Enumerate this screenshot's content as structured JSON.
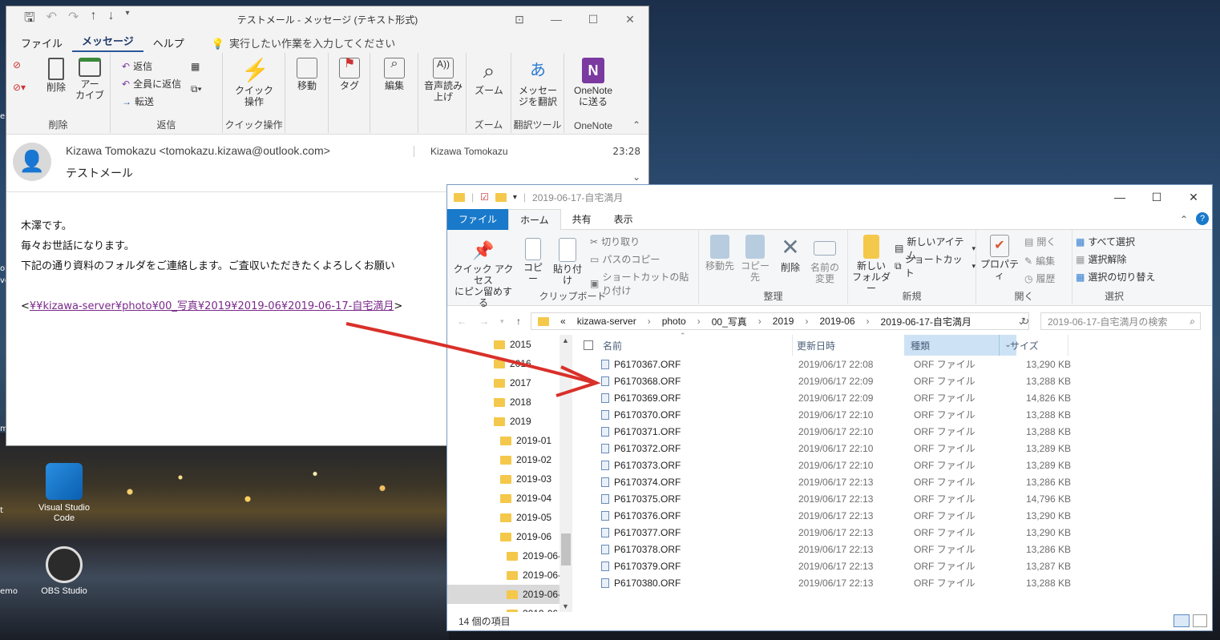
{
  "desktop": {
    "icons": [
      {
        "label": "Visual Studio Code"
      },
      {
        "label": "OBS Studio"
      }
    ],
    "edge_labels": [
      "e",
      "ol",
      "ve",
      "m",
      "t",
      "emo"
    ]
  },
  "outlook": {
    "title": "テストメール  -  メッセージ (テキスト形式)",
    "menu": [
      "ファイル",
      "メッセージ",
      "ヘルプ"
    ],
    "tell_me": "実行したい作業を入力してください",
    "ribbon": {
      "delete_group": "削除",
      "delete": "削除",
      "archive": "アー\nカイブ",
      "reply_group": "返信",
      "reply": "返信",
      "reply_all": "全員に返信",
      "forward": "転送",
      "quick_group": "クイック操作",
      "quick": "クイック\n操作",
      "move": "移動",
      "tag": "タグ",
      "edit": "編集",
      "read_aloud": "音声読み\n上げ",
      "zoom_group": "ズーム",
      "zoom": "ズーム",
      "translate_group": "翻訳ツール",
      "translate": "メッセー\nジを翻訳",
      "onenote_group": "OneNote",
      "onenote": "OneNote\nに送る"
    },
    "header": {
      "from": "Kizawa Tomokazu <tomokazu.kizawa@outlook.com>",
      "to": "Kizawa Tomokazu",
      "time": "23:28",
      "subject": "テストメール"
    },
    "body": [
      "木澤です。",
      "毎々お世話になります。",
      "下記の通り資料のフォルダをご連絡します。ご査収いただきたくよろしくお願い"
    ],
    "link_open": "<",
    "link": "¥¥kizawa-server¥photo¥00_写真¥2019¥2019-06¥2019-06-17-自宅満月",
    "link_close": ">"
  },
  "explorer": {
    "title": "2019-06-17-自宅満月",
    "tabs": [
      "ファイル",
      "ホーム",
      "共有",
      "表示"
    ],
    "ribbon": {
      "pin": "クイック アクセス\nにピン留めする",
      "copy": "コピー",
      "paste": "貼り付け",
      "cut": "切り取り",
      "copy_path": "パスのコピー",
      "paste_shortcut": "ショートカットの貼り付け",
      "clipboard_group": "クリップボード",
      "move_to": "移動先",
      "copy_to": "コピー先",
      "delete": "削除",
      "rename": "名前の\n変更",
      "organize_group": "整理",
      "new_folder": "新しい\nフォルダー",
      "new_item": "新しいアイテム",
      "shortcut": "ショートカット",
      "new_group": "新規",
      "properties": "プロパティ",
      "open": "開く",
      "edit": "編集",
      "history": "履歴",
      "open_group": "開く",
      "select_all": "すべて選択",
      "select_none": "選択解除",
      "invert": "選択の切り替え",
      "select_group": "選択"
    },
    "address": [
      "«",
      "kizawa-server",
      "photo",
      "00_写真",
      "2019",
      "2019-06",
      "2019-06-17-自宅満月"
    ],
    "search_placeholder": "2019-06-17-自宅満月の検索",
    "nav": [
      {
        "label": "2015",
        "indent": 0
      },
      {
        "label": "2016",
        "indent": 0
      },
      {
        "label": "2017",
        "indent": 0
      },
      {
        "label": "2018",
        "indent": 0
      },
      {
        "label": "2019",
        "indent": 0
      },
      {
        "label": "2019-01",
        "indent": 1
      },
      {
        "label": "2019-02",
        "indent": 1
      },
      {
        "label": "2019-03",
        "indent": 1
      },
      {
        "label": "2019-04",
        "indent": 1
      },
      {
        "label": "2019-05",
        "indent": 1
      },
      {
        "label": "2019-06",
        "indent": 1
      },
      {
        "label": "2019-06-",
        "indent": 2
      },
      {
        "label": "2019-06-",
        "indent": 2
      },
      {
        "label": "2019-06-",
        "indent": 2,
        "selected": true
      },
      {
        "label": "2019-06-",
        "indent": 2
      }
    ],
    "columns": [
      "名前",
      "更新日時",
      "種類",
      "サイズ"
    ],
    "files": [
      [
        "P6170367.ORF",
        "2019/06/17 22:08",
        "ORF ファイル",
        "13,290 KB"
      ],
      [
        "P6170368.ORF",
        "2019/06/17 22:09",
        "ORF ファイル",
        "13,288 KB"
      ],
      [
        "P6170369.ORF",
        "2019/06/17 22:09",
        "ORF ファイル",
        "14,826 KB"
      ],
      [
        "P6170370.ORF",
        "2019/06/17 22:10",
        "ORF ファイル",
        "13,288 KB"
      ],
      [
        "P6170371.ORF",
        "2019/06/17 22:10",
        "ORF ファイル",
        "13,288 KB"
      ],
      [
        "P6170372.ORF",
        "2019/06/17 22:10",
        "ORF ファイル",
        "13,289 KB"
      ],
      [
        "P6170373.ORF",
        "2019/06/17 22:10",
        "ORF ファイル",
        "13,289 KB"
      ],
      [
        "P6170374.ORF",
        "2019/06/17 22:13",
        "ORF ファイル",
        "13,286 KB"
      ],
      [
        "P6170375.ORF",
        "2019/06/17 22:13",
        "ORF ファイル",
        "14,796 KB"
      ],
      [
        "P6170376.ORF",
        "2019/06/17 22:13",
        "ORF ファイル",
        "13,290 KB"
      ],
      [
        "P6170377.ORF",
        "2019/06/17 22:13",
        "ORF ファイル",
        "13,290 KB"
      ],
      [
        "P6170378.ORF",
        "2019/06/17 22:13",
        "ORF ファイル",
        "13,286 KB"
      ],
      [
        "P6170379.ORF",
        "2019/06/17 22:13",
        "ORF ファイル",
        "13,287 KB"
      ],
      [
        "P6170380.ORF",
        "2019/06/17 22:13",
        "ORF ファイル",
        "13,288 KB"
      ]
    ],
    "status": "14 個の項目"
  },
  "colors": {
    "accent": "#2b579a",
    "file_tab": "#1979ca",
    "annotation": "#d9302a",
    "link": "#7a2a8a"
  }
}
